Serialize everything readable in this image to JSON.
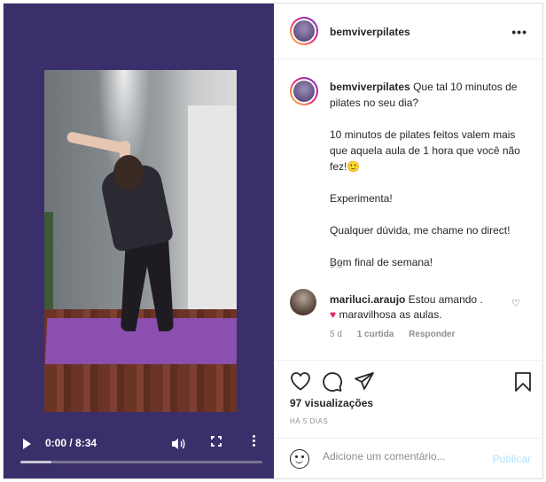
{
  "post": {
    "username": "bemviverpilates",
    "more_label": "•••",
    "caption": {
      "intro": "Que tal 10 minutos de pilates no seu dia?",
      "p2": "10 minutos de pilates feitos valem mais que aquela aula de 1 hora que você não fez!🙂",
      "p3": "Experimenta!",
      "p4": "Qualquer dúvida, me chame no direct!",
      "p5": "Bom final de semana!"
    },
    "caption_age": "5 d"
  },
  "video": {
    "time": "0:00 / 8:34",
    "progress_fraction": 0.13
  },
  "comment": {
    "username": "mariluci.araujo",
    "text_a": "Estou amando .",
    "text_b": "maravilhosa as aulas.",
    "age": "5 d",
    "likes": "1 curtida",
    "reply": "Responder"
  },
  "stats": {
    "views": "97 visualizações",
    "posted": "HÁ 5 DIAS"
  },
  "composer": {
    "placeholder": "Adicione um comentário...",
    "publish": "Publicar"
  },
  "colors": {
    "media_bg": "#3b2f6b",
    "publish_disabled": "#b2dffc"
  },
  "icons": [
    "play-icon",
    "volume-icon",
    "fullscreen-icon",
    "video-more-icon",
    "more-icon",
    "heart-icon",
    "comment-icon",
    "share-icon",
    "bookmark-icon",
    "emoji-icon",
    "small-heart-icon",
    "red-heart-emoji"
  ]
}
